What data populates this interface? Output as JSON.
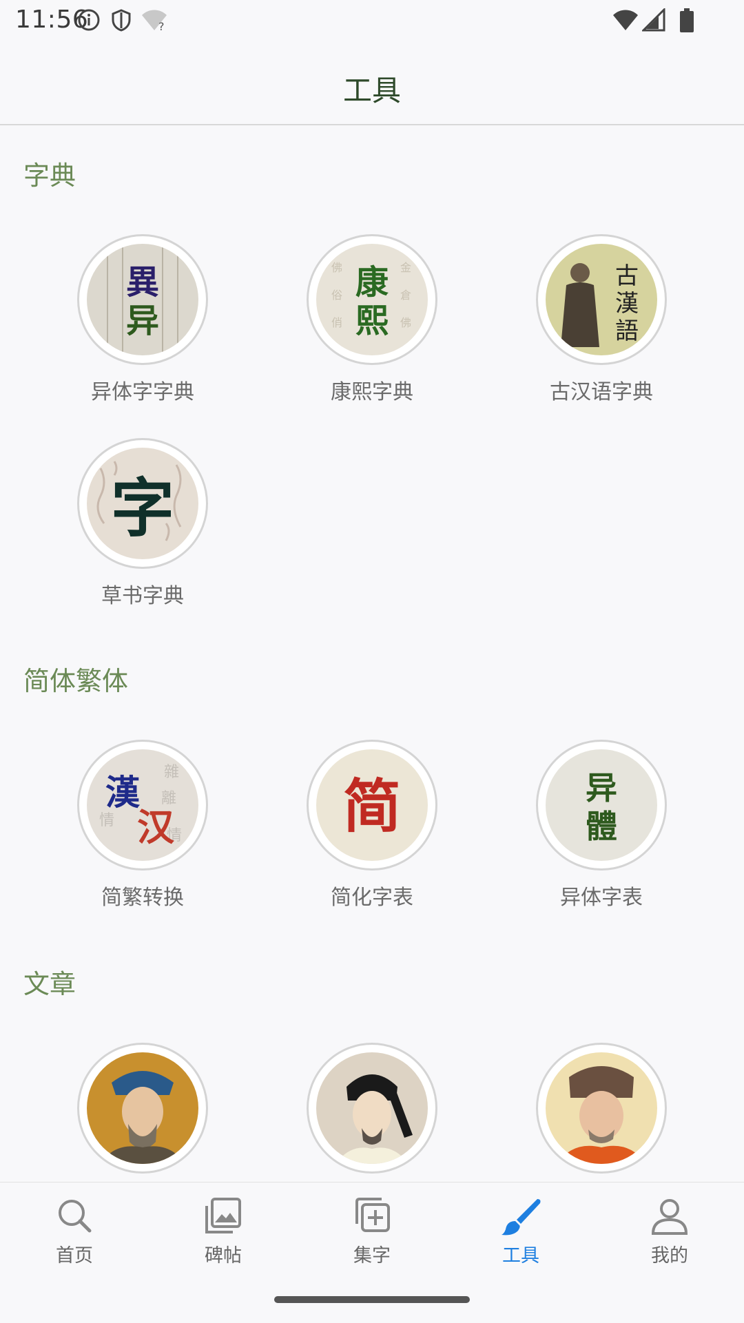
{
  "status": {
    "time": "11:56"
  },
  "header": {
    "title": "工具"
  },
  "sections": [
    {
      "title": "字典",
      "tools": [
        {
          "label": "异体字字典",
          "icon": "yiti-dictionary-icon",
          "chars": [
            "異",
            "异"
          ]
        },
        {
          "label": "康熙字典",
          "icon": "kangxi-dictionary-icon",
          "chars": [
            "康",
            "熙"
          ]
        },
        {
          "label": "古汉语字典",
          "icon": "classical-chinese-dictionary-icon",
          "chars": [
            "古",
            "漢",
            "語"
          ]
        },
        {
          "label": "草书字典",
          "icon": "cursive-dictionary-icon",
          "chars": [
            "字"
          ]
        }
      ]
    },
    {
      "title": "简体繁体",
      "tools": [
        {
          "label": "简繁转换",
          "icon": "simplified-traditional-convert-icon",
          "chars": [
            "漢",
            "汉"
          ]
        },
        {
          "label": "简化字表",
          "icon": "simplified-table-icon",
          "chars": [
            "简"
          ]
        },
        {
          "label": "异体字表",
          "icon": "variant-table-icon",
          "chars": [
            "异",
            "體"
          ]
        }
      ]
    },
    {
      "title": "文章",
      "tools": [
        {
          "label": "",
          "icon": "scholar-portrait-icon"
        },
        {
          "label": "",
          "icon": "scholar-portrait-icon"
        },
        {
          "label": "",
          "icon": "scholar-portrait-icon"
        }
      ]
    }
  ],
  "nav": [
    {
      "label": "首页",
      "icon": "search-icon",
      "active": false
    },
    {
      "label": "碑帖",
      "icon": "gallery-icon",
      "active": false
    },
    {
      "label": "集字",
      "icon": "add-collection-icon",
      "active": false
    },
    {
      "label": "工具",
      "icon": "brush-icon",
      "active": true
    },
    {
      "label": "我的",
      "icon": "profile-icon",
      "active": false
    }
  ],
  "colors": {
    "accent": "#1e7fe0",
    "section_title": "#6b8a56",
    "header_title": "#2e4a2a"
  }
}
